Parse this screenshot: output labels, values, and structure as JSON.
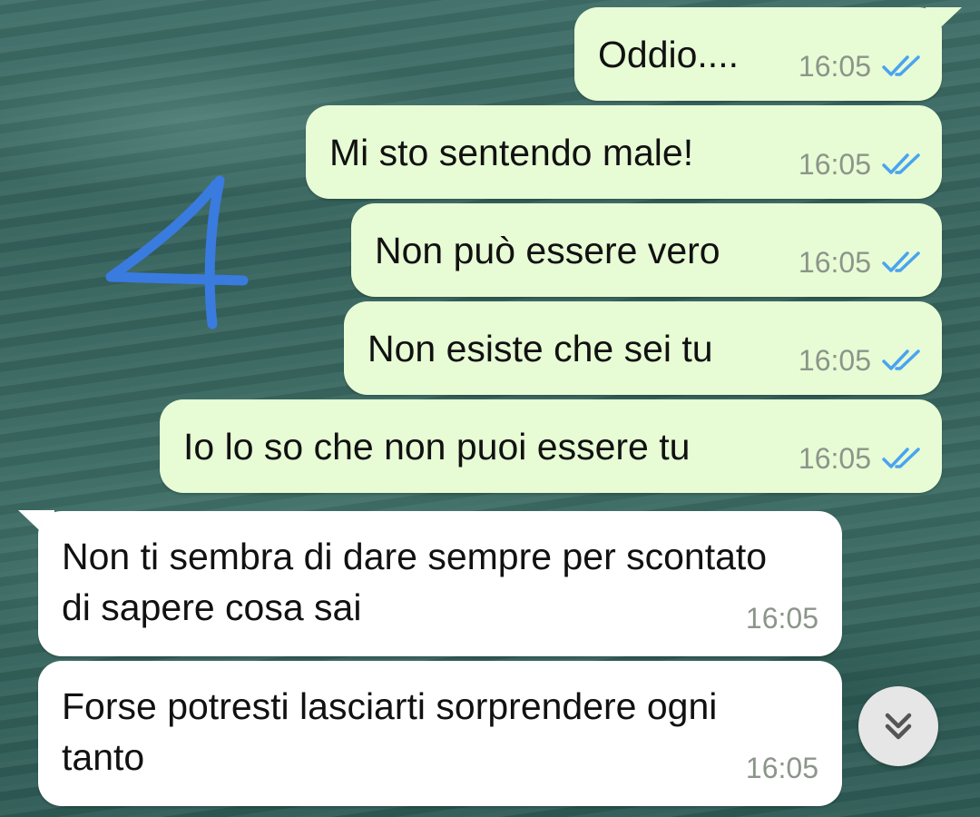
{
  "annotation": {
    "glyph": "4",
    "color": "#3a7be0"
  },
  "messages_out": [
    {
      "text": "Oddio....",
      "time": "16:05",
      "status": "read"
    },
    {
      "text": "Mi sto sentendo male!",
      "time": "16:05",
      "status": "read"
    },
    {
      "text": "Non può essere vero",
      "time": "16:05",
      "status": "read"
    },
    {
      "text": "Non esiste che sei tu",
      "time": "16:05",
      "status": "read"
    },
    {
      "text": "Io lo so che non puoi essere tu",
      "time": "16:05",
      "status": "read"
    }
  ],
  "messages_in": [
    {
      "text": "Non ti sembra di dare sempre per scontato di sapere cosa sai",
      "time": "16:05"
    },
    {
      "text": "Forse potresti lasciarti sorprendere ogni tanto",
      "time": "16:05"
    }
  ],
  "colors": {
    "outgoing_bubble": "#e7fcd5",
    "incoming_bubble": "#ffffff",
    "read_ticks": "#4aa3f0",
    "timestamp": "#8c958a"
  },
  "icons": {
    "read_receipt": "double-check-icon",
    "scroll_down": "chevron-double-down-icon"
  }
}
